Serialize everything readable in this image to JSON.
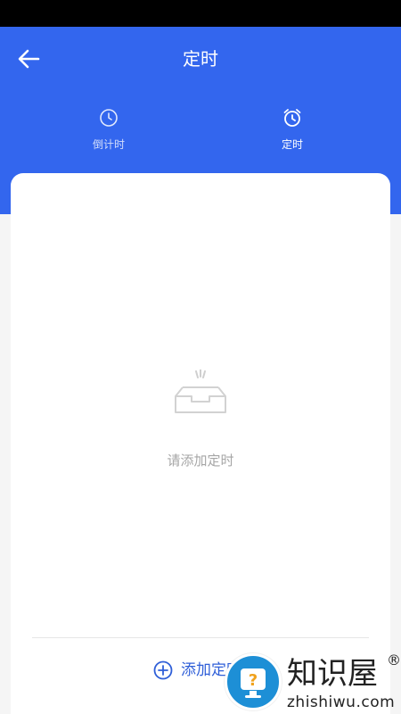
{
  "header": {
    "title": "定时",
    "back_icon": "arrow-left-icon",
    "background_color": "#3366ee"
  },
  "tabs": [
    {
      "label": "倒计时",
      "icon": "clock-icon",
      "active": false
    },
    {
      "label": "定时",
      "icon": "alarm-clock-icon",
      "active": true
    }
  ],
  "empty_state": {
    "icon": "empty-inbox-icon",
    "text": "请添加定时"
  },
  "footer": {
    "add_icon": "plus-circle-icon",
    "add_label": "添加定时",
    "accent_color": "#2f5fd8"
  },
  "watermark": {
    "text": "知识屋",
    "domain": "zhishiwu.com",
    "registered": "®"
  }
}
